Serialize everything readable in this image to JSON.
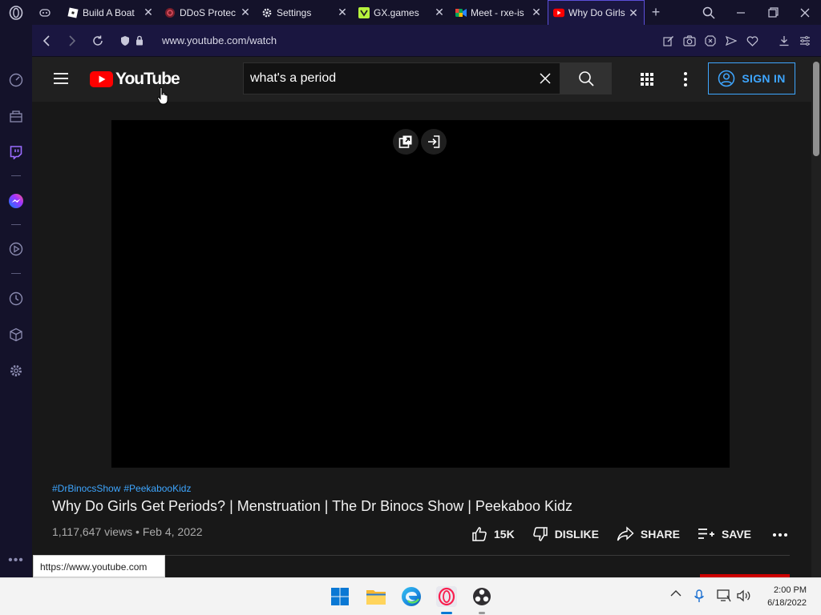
{
  "browser": {
    "tabs": [
      {
        "title": "",
        "icon": "gamepad-icon"
      },
      {
        "title": "Build A Boat",
        "icon": "roblox-icon"
      },
      {
        "title": "DDoS Protec",
        "icon": "ddos-guard-icon"
      },
      {
        "title": "Settings",
        "icon": "gear-icon"
      },
      {
        "title": "GX.games",
        "icon": "gx-games-icon"
      },
      {
        "title": "Meet - rxe-is",
        "icon": "google-meet-icon"
      },
      {
        "title": "Why Do Girls",
        "icon": "youtube-icon",
        "active": true
      }
    ],
    "url": "www.youtube.com/watch",
    "status_url": "https://www.youtube.com"
  },
  "youtube": {
    "logo_text": "YouTube",
    "search_value": "what's a period",
    "signin_label": "SIGN IN",
    "hashtags": [
      "#DrBinocsShow",
      "#PeekabooKidz"
    ],
    "video_title": "Why Do Girls Get Periods? | Menstruation | The Dr Binocs Show | Peekaboo Kidz",
    "views": "1,117,647 views",
    "separator": "•",
    "date": "Feb 4, 2022",
    "actions": {
      "like_count": "15K",
      "dislike_label": "DISLIKE",
      "share_label": "SHARE",
      "save_label": "SAVE"
    }
  },
  "taskbar": {
    "time": "2:00 PM",
    "date": "6/18/2022"
  },
  "colors": {
    "accent": "#3ea6ff",
    "youtube_red": "#ff0000",
    "opera_accent": "#5b4fd9"
  }
}
